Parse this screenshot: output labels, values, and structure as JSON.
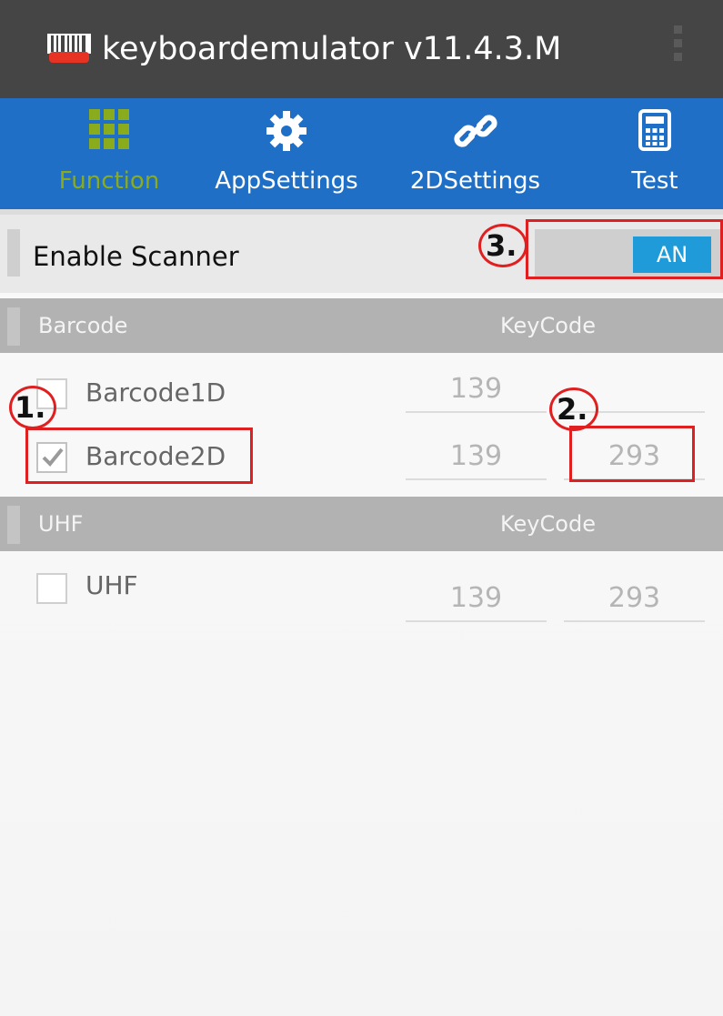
{
  "app": {
    "title": "keyboardemulator v11.4.3.M",
    "icon": "barcode-scanner-icon"
  },
  "tabs": [
    {
      "label": "Function",
      "icon": "grid-icon",
      "active": true
    },
    {
      "label": "AppSettings",
      "icon": "gear-icon",
      "active": false
    },
    {
      "label": "2DSettings",
      "icon": "link-icon",
      "active": false
    },
    {
      "label": "Test",
      "icon": "calculator-icon",
      "active": false
    }
  ],
  "enable_scanner": {
    "label": "Enable Scanner",
    "toggle_label": "AN"
  },
  "barcode_section": {
    "header_left": "Barcode",
    "header_right": "KeyCode",
    "rows": [
      {
        "name": "Barcode1D",
        "checked": false,
        "key1": "139",
        "key2": ""
      },
      {
        "name": "Barcode2D",
        "checked": true,
        "key1": "139",
        "key2": "293"
      }
    ]
  },
  "uhf_section": {
    "header_left": "UHF",
    "header_right": "KeyCode",
    "rows": [
      {
        "name": "UHF",
        "checked": false,
        "key1": "139",
        "key2": "293"
      }
    ]
  },
  "annotations": [
    "1.",
    "2.",
    "3."
  ],
  "colors": {
    "titlebar": "#454545",
    "tabbar": "#1f6fc6",
    "active_tab": "#8aac1c",
    "toggle_on": "#1e9bd8",
    "annotation": "#e02020"
  }
}
